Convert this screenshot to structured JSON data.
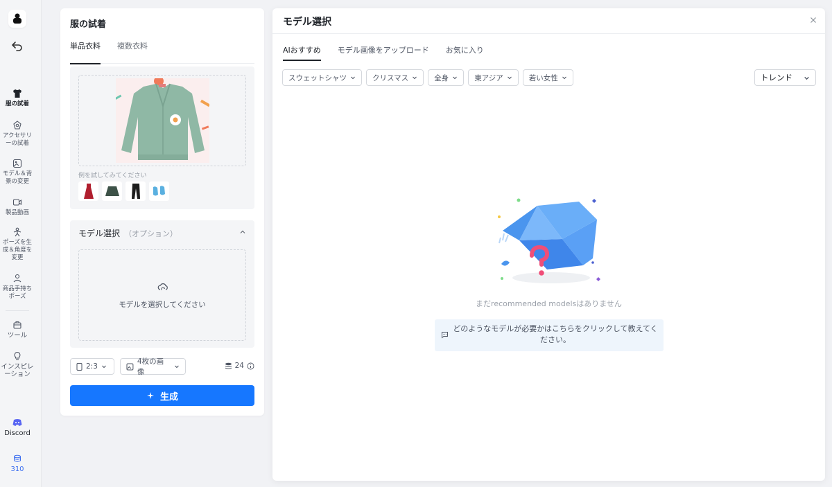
{
  "sidebar": {
    "items": [
      {
        "label": "服の試着"
      },
      {
        "label": "アクセサリーの試着"
      },
      {
        "label": "モデル＆背景の変更"
      },
      {
        "label": "製品動画"
      },
      {
        "label": "ポーズを生成＆角度を変更"
      },
      {
        "label": "商品手持ちポーズ"
      },
      {
        "label": "ツール"
      },
      {
        "label": "インスピレーション"
      }
    ],
    "discord_label": "Discord",
    "credits": "310"
  },
  "panel": {
    "title": "服の試着",
    "tabs": [
      "単品衣料",
      "複数衣料"
    ],
    "examples_label": "例を試してみてください",
    "model_section_title": "モデル選択",
    "model_section_optional": "（オプション）",
    "model_placeholder": "モデルを選択してください",
    "ratio": "2:3",
    "image_count": "4枚の画像",
    "cost": "24",
    "generate_label": "生成"
  },
  "modal": {
    "title": "モデル選択",
    "tabs": [
      "AIおすすめ",
      "モデル画像をアップロード",
      "お気に入り"
    ],
    "filters": [
      "スウェットシャツ",
      "クリスマス",
      "全身",
      "東アジア",
      "若い女性"
    ],
    "sort": "トレンド",
    "empty_text": "まだrecommended modelsはありません",
    "feedback_text": "どのようなモデルが必要かはこちらをクリックして教えてください。"
  },
  "colors": {
    "primary": "#1677ff",
    "box_blue": "#5aa0f5",
    "question_pink": "#f04e78"
  }
}
